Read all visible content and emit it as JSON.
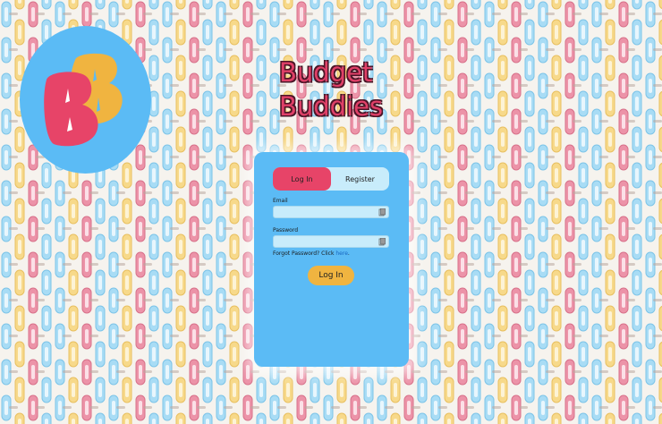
{
  "app": {
    "title_line1": "Budget",
    "title_line2": "Buddies",
    "logo_letters": "BB"
  },
  "colors": {
    "brand_pink": "#e74468",
    "brand_yellow": "#f0b440",
    "brand_blue": "#5bbbf5",
    "light_blue": "#c8ecfb"
  },
  "auth": {
    "tabs": [
      {
        "label": "Log In",
        "active": true
      },
      {
        "label": "Register",
        "active": false
      }
    ],
    "email": {
      "label": "Email",
      "value": ""
    },
    "password": {
      "label": "Password",
      "value": ""
    },
    "forgot_text": "Forgot Password? Click",
    "forgot_link": "here",
    "forgot_end": ".",
    "submit_label": "Log In"
  },
  "icons": {
    "field_icon": "clipboard-icon",
    "logo": "budget-buddies-logo"
  }
}
